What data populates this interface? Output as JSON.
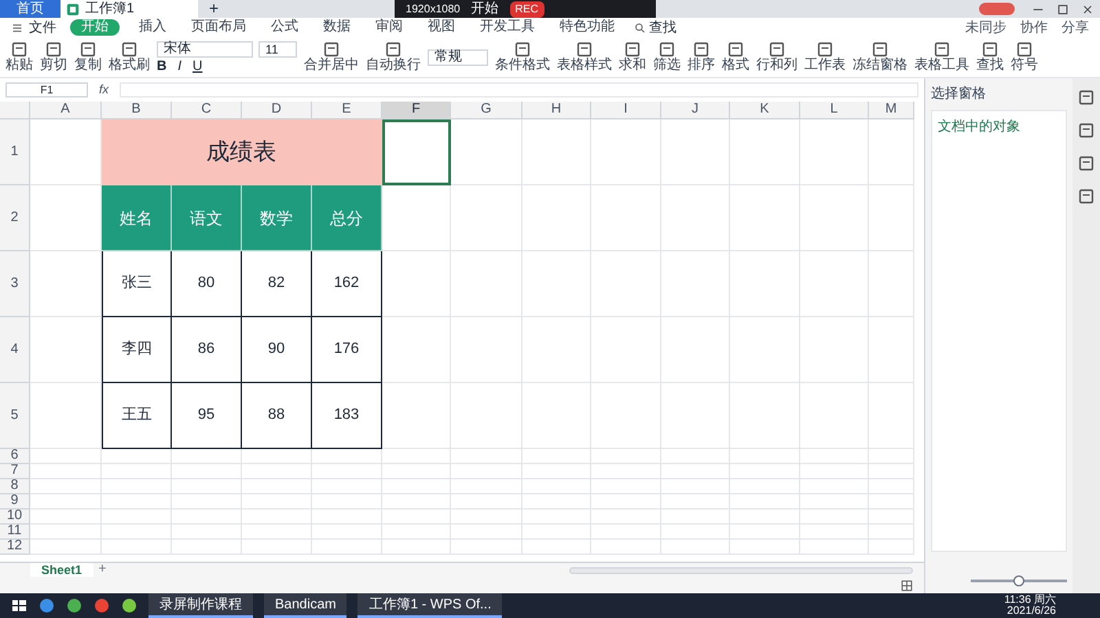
{
  "title_bar": {
    "home_tab": "首页",
    "doc_tab": "工作簿1",
    "new_tab": "+",
    "recorder": {
      "resolution": "1920x1080",
      "mode": "开始",
      "rec": "REC"
    }
  },
  "menu": {
    "file": "文件",
    "tabs": [
      {
        "label": "开始",
        "selected": true
      },
      {
        "label": "插入",
        "selected": false
      },
      {
        "label": "页面布局",
        "selected": false
      },
      {
        "label": "公式",
        "selected": false
      },
      {
        "label": "数据",
        "selected": false
      },
      {
        "label": "审阅",
        "selected": false
      },
      {
        "label": "视图",
        "selected": false
      },
      {
        "label": "开发工具",
        "selected": false
      },
      {
        "label": "特色功能",
        "selected": false
      }
    ],
    "search": "查找",
    "right": [
      "未同步",
      "协作",
      "分享"
    ]
  },
  "toolbar": {
    "left": [
      "粘贴",
      "剪切",
      "复制",
      "格式刷"
    ],
    "font": "宋体",
    "size": "11",
    "format_buttons": [
      "B",
      "I",
      "U"
    ],
    "align": [
      "合并居中",
      "自动换行"
    ],
    "number_format": "常规",
    "tools": [
      "条件格式",
      "表格样式",
      "求和",
      "筛选",
      "排序",
      "格式",
      "行和列",
      "工作表",
      "冻结窗格",
      "表格工具",
      "查找",
      "符号"
    ]
  },
  "formula_bar": {
    "name_box": "F1",
    "fx": "fx"
  },
  "sheet": {
    "columns": [
      {
        "label": "A",
        "selected": false
      },
      {
        "label": "B",
        "selected": false
      },
      {
        "label": "C",
        "selected": false
      },
      {
        "label": "D",
        "selected": false
      },
      {
        "label": "E",
        "selected": false
      },
      {
        "label": "F",
        "selected": true
      },
      {
        "label": "G",
        "selected": false
      },
      {
        "label": "H",
        "selected": false
      },
      {
        "label": "I",
        "selected": false
      },
      {
        "label": "J",
        "selected": false
      },
      {
        "label": "K",
        "selected": false
      },
      {
        "label": "L",
        "selected": false
      },
      {
        "label": "M",
        "selected": false
      }
    ],
    "rows": [
      {
        "label": "1",
        "kind": "tall"
      },
      {
        "label": "2",
        "kind": "tall"
      },
      {
        "label": "3",
        "kind": "tall"
      },
      {
        "label": "4",
        "kind": "tall"
      },
      {
        "label": "5",
        "kind": "tall"
      },
      {
        "label": "6",
        "kind": "short"
      },
      {
        "label": "7",
        "kind": "short"
      },
      {
        "label": "8",
        "kind": "short"
      },
      {
        "label": "9",
        "kind": "short"
      },
      {
        "label": "10",
        "kind": "short"
      },
      {
        "label": "11",
        "kind": "short"
      },
      {
        "label": "12",
        "kind": "short"
      }
    ],
    "table": {
      "title": "成绩表",
      "headers": [
        "姓名",
        "语文",
        "数学",
        "总分"
      ],
      "rows": [
        [
          "张三",
          "80",
          "82",
          "162"
        ],
        [
          "李四",
          "86",
          "90",
          "176"
        ],
        [
          "王五",
          "95",
          "88",
          "183"
        ]
      ]
    },
    "sheet_tabs": [
      {
        "label": "Sheet1",
        "selected": true
      }
    ],
    "add_sheet": "+"
  },
  "side_panel": {
    "title": "选择窗格",
    "subtitle": "文档中的对象"
  },
  "status_bar": {
    "zoom": {
      "level": 0.5
    }
  },
  "taskbar": {
    "apps": [
      "录屏制作课程",
      "Bandicam",
      "工作簿1 - WPS Of..."
    ],
    "time": "11:36 周六",
    "date": "2021/6/26"
  }
}
